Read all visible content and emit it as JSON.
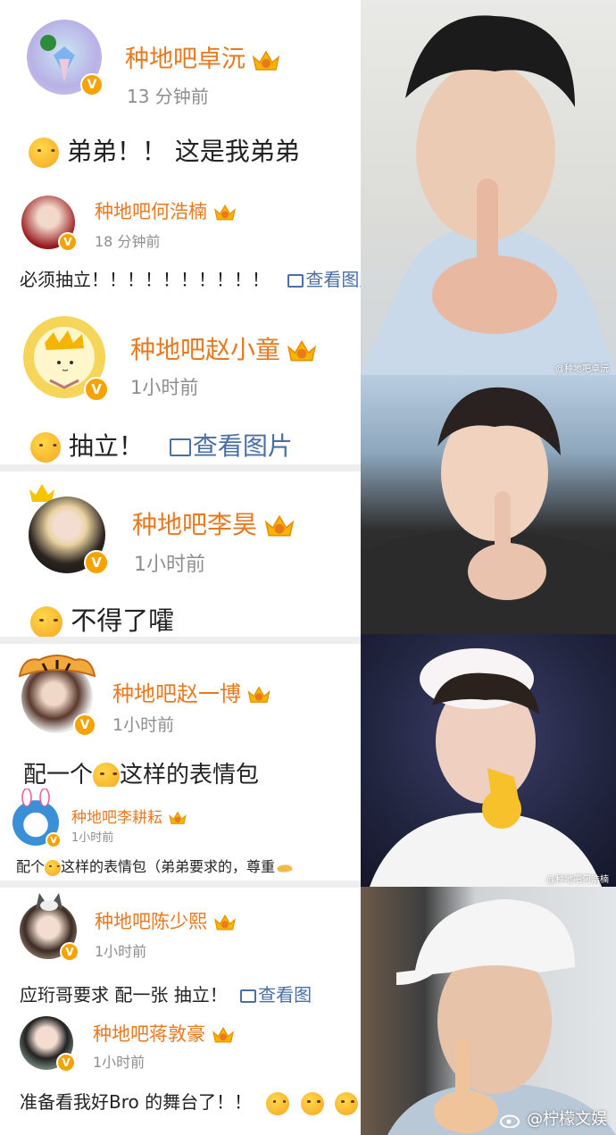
{
  "posts": [
    {
      "name": "种地吧卓沅",
      "time": "13 分钟前",
      "text": "弟弟！！ 这是我弟弟"
    },
    {
      "name": "种地吧何浩楠",
      "time": "18 分钟前",
      "text": "必须抽立！！！！！！！！！！",
      "link": "查看图片"
    },
    {
      "name": "种地吧赵小童",
      "time": "1小时前",
      "text": "抽立！",
      "link": "查看图片"
    },
    {
      "name": "种地吧李昊",
      "time": "1小时前",
      "text": "不得了嚯"
    },
    {
      "name": "种地吧赵一博",
      "time": "1小时前",
      "text_a": "配一个",
      "text_b": "这样的表情包"
    },
    {
      "name": "种地吧李耕耘",
      "time": "1小时前",
      "text_a": "配个",
      "text_b": "这样的表情包（弟弟要求的，尊重"
    },
    {
      "name": "种地吧陈少熙",
      "time": "1小时前",
      "text": "应珩哥要求 配一张 抽立！",
      "link": "查看图"
    },
    {
      "name": "种地吧蒋敦豪",
      "time": "1小时前",
      "text": "准备看我好Bro 的舞台了！！"
    }
  ],
  "badge_letter": "V",
  "watermarks": {
    "photo1": "@种地吧卓沅",
    "photo3": "@种地吧何浩楠",
    "footer": "@柠檬文娱"
  },
  "colors": {
    "name": "#e8791f",
    "time": "#8e8e8e",
    "link": "#4a6fa5",
    "badge": "#f6a300"
  }
}
